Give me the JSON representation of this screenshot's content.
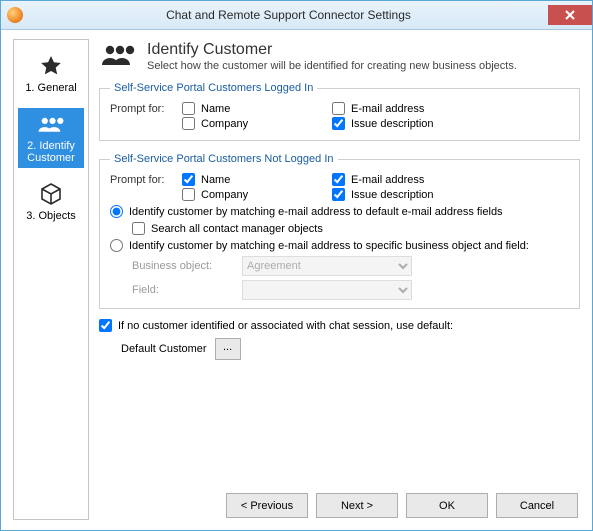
{
  "titlebar": {
    "title": "Chat and Remote Support Connector Settings"
  },
  "sidebar": {
    "steps": [
      {
        "label": "1. General"
      },
      {
        "label": "2. Identify Customer"
      },
      {
        "label": "3. Objects"
      }
    ]
  },
  "header": {
    "title": "Identify Customer",
    "subtitle": "Select how the customer will be identified for creating new business objects."
  },
  "group_logged_in": {
    "legend": "Self-Service Portal Customers Logged In",
    "prompt_label": "Prompt for:",
    "name": "Name",
    "email": "E-mail address",
    "company": "Company",
    "issue": "Issue description"
  },
  "group_not_logged_in": {
    "legend": "Self-Service Portal Customers Not Logged In",
    "prompt_label": "Prompt for:",
    "name": "Name",
    "email": "E-mail address",
    "company": "Company",
    "issue": "Issue description",
    "radio_default": "Identify customer by matching e-mail address to default e-mail address fields",
    "search_all": "Search all contact manager objects",
    "radio_specific": "Identify customer by matching e-mail address to specific business object and field:",
    "bo_label": "Business object:",
    "bo_value": "Agreement",
    "field_label": "Field:"
  },
  "default_section": {
    "check_label": "If no customer identified or associated with chat session, use default:",
    "default_label": "Default Customer",
    "browse": "..."
  },
  "footer": {
    "previous": "< Previous",
    "next": "Next >",
    "ok": "OK",
    "cancel": "Cancel"
  }
}
